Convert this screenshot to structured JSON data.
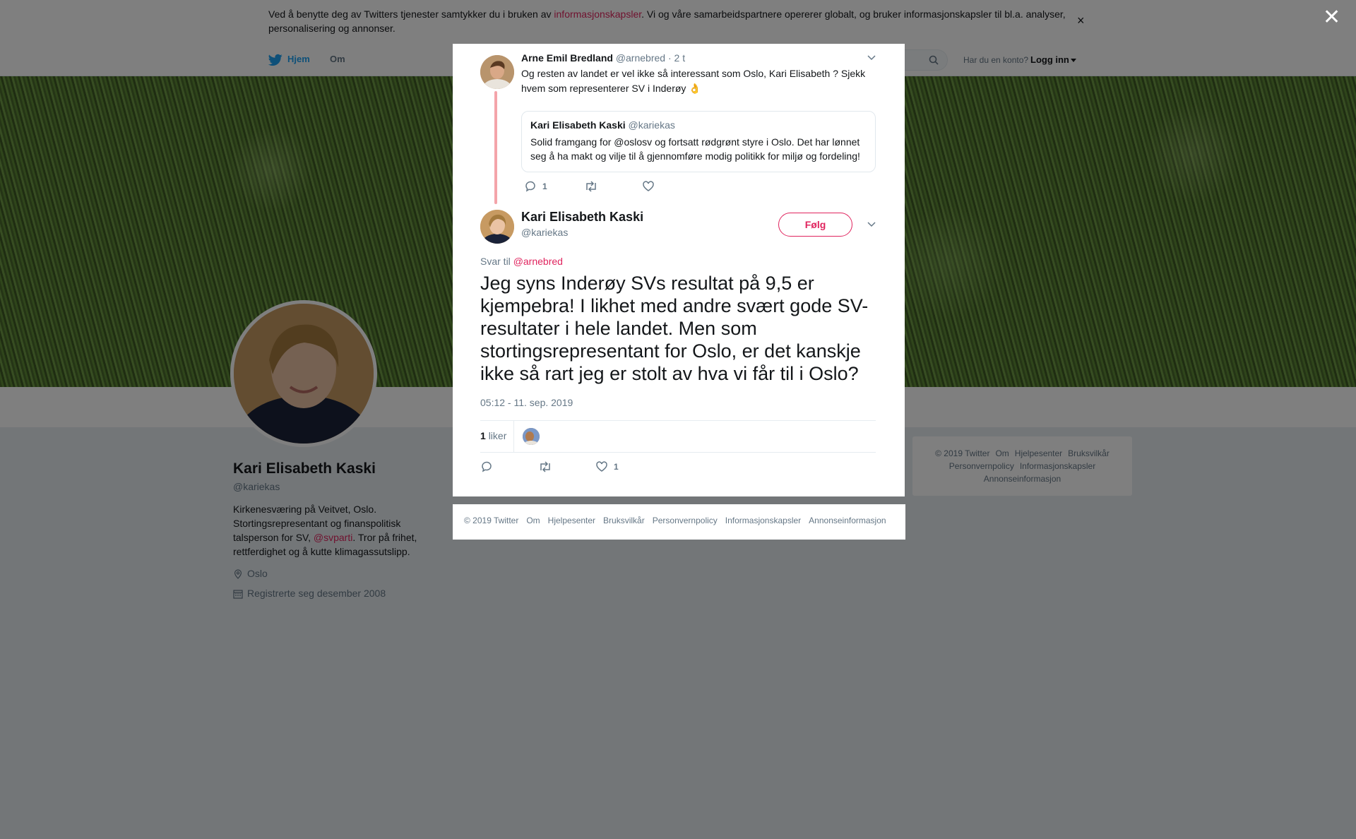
{
  "cookie_banner": {
    "text_before": "Ved å benytte deg av Twitters tjenester samtykker du i bruken av ",
    "link": "informasjonskapsler",
    "text_after": ". Vi og våre samarbeidspartnere opererer globalt, og bruker informasjonskapsler til bl.a. analyser, personalisering og annonser.",
    "close": "×"
  },
  "nav": {
    "home": "Hjem",
    "about": "Om",
    "account_question": "Har du en konto?",
    "login": "Logg inn"
  },
  "profile": {
    "name": "Kari Elisabeth Kaski",
    "handle": "@kariekas",
    "bio_before": "Kirkenesværing på Veitvet, Oslo. Stortingsrepresentant og finanspolitisk talsperson for SV, ",
    "bio_mention": "@svparti",
    "bio_after": ". Tror på frihet, rettferdighet og å kutte klimagassutslipp.",
    "location": "Oslo",
    "joined": "Registrerte seg desember 2008"
  },
  "side_footer": {
    "items": [
      "© 2019 Twitter",
      "Om",
      "Hjelpesenter",
      "Bruksvilkår",
      "Personvernpolicy",
      "Informasjonskapsler",
      "Annonseinformasjon"
    ]
  },
  "overlay": {
    "close": "✕"
  },
  "modal": {
    "parent_tweet": {
      "name": "Arne Emil Bredland",
      "handle": "@arnebred",
      "time": "· 2 t",
      "text": "Og resten av landet er vel ikke så interessant som Oslo, Kari Elisabeth ? Sjekk hvem som representerer SV i Inderøy 👌",
      "quote": {
        "name": "Kari Elisabeth Kaski",
        "handle": "@kariekas",
        "text": "Solid framgang for @oslosv og fortsatt rødgrønt styre i Oslo. Det har lønnet seg å ha makt og vilje til å gjennomføre modig politikk for miljø og fordeling!"
      },
      "reply_count": "1"
    },
    "main_tweet": {
      "name": "Kari Elisabeth Kaski",
      "handle": "@kariekas",
      "follow": "Følg",
      "reply_to_label": "Svar til ",
      "reply_to_mention": "@arnebred",
      "text": "Jeg syns Inderøy SVs resultat på 9,5 er kjempebra! I likhet med andre svært gode SV-resultater i hele landet. Men som stortingsrepresentant for Oslo, er det kanskje ikke så rart jeg er stolt av hva vi får til i Oslo?",
      "timestamp": "05:12 - 11. sep. 2019",
      "likes_number": "1",
      "likes_label": "liker",
      "like_count": "1"
    },
    "footer": {
      "items": [
        "© 2019 Twitter",
        "Om",
        "Hjelpesenter",
        "Bruksvilkår",
        "Personvernpolicy",
        "Informasjonskapsler",
        "Annonseinformasjon"
      ]
    }
  },
  "colors": {
    "accent": "#e0245e",
    "twitter_blue": "#1da1f2",
    "secondary_text": "#657786",
    "thread_line": "#f4a4aa"
  }
}
